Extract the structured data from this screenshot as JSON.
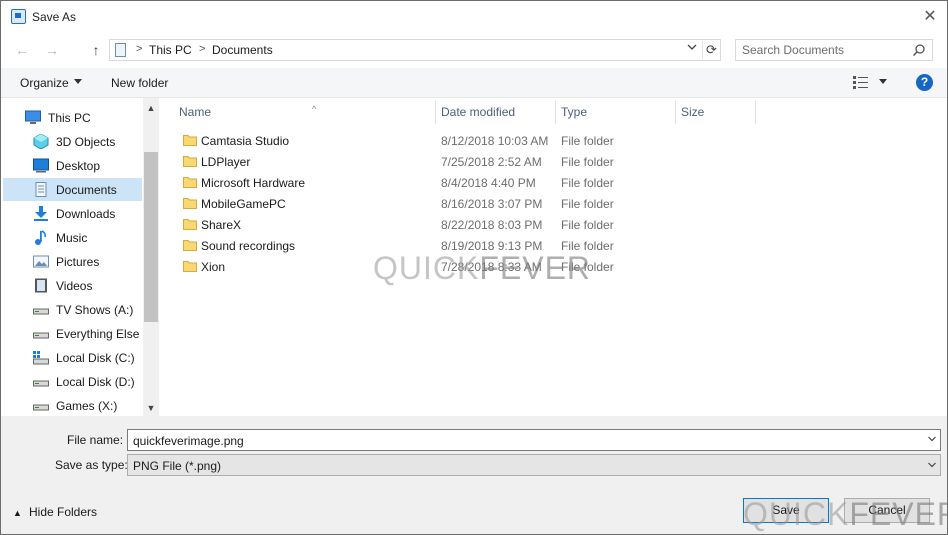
{
  "window": {
    "title": "Save As",
    "close_glyph": "✕"
  },
  "navigation": {
    "back_glyph": "←",
    "forward_glyph": "→",
    "up_glyph": "↑",
    "breadcrumb": [
      {
        "label": "This PC"
      },
      {
        "label": "Documents"
      }
    ],
    "separator_glyph": ">",
    "dropdown_glyph": "⌄",
    "refresh_glyph": "⟳"
  },
  "search": {
    "placeholder": "Search Documents",
    "icon": "search-icon"
  },
  "commandbar": {
    "organize_label": "Organize",
    "new_folder_label": "New folder",
    "help_label": "?",
    "view_icon": "view-options-icon"
  },
  "sidebar": {
    "items": [
      {
        "label": "This PC",
        "icon": "this-pc-icon",
        "root": true
      },
      {
        "label": "3D Objects",
        "icon": "3d-objects-icon"
      },
      {
        "label": "Desktop",
        "icon": "desktop-icon"
      },
      {
        "label": "Documents",
        "icon": "documents-icon",
        "selected": true
      },
      {
        "label": "Downloads",
        "icon": "downloads-icon"
      },
      {
        "label": "Music",
        "icon": "music-icon"
      },
      {
        "label": "Pictures",
        "icon": "pictures-icon"
      },
      {
        "label": "Videos",
        "icon": "videos-icon"
      },
      {
        "label": "TV Shows (A:)",
        "icon": "network-drive-icon"
      },
      {
        "label": "Everything Else (",
        "icon": "network-drive-icon"
      },
      {
        "label": "Local Disk (C:)",
        "icon": "local-disk-icon"
      },
      {
        "label": "Local Disk (D:)",
        "icon": "local-disk-icon"
      },
      {
        "label": "Games (X:)",
        "icon": "network-drive-icon"
      }
    ],
    "scroll_up_glyph": "▲",
    "scroll_down_glyph": "▼"
  },
  "filelist": {
    "columns": [
      {
        "label": "Name"
      },
      {
        "label": "Date modified"
      },
      {
        "label": "Type"
      },
      {
        "label": "Size"
      }
    ],
    "sort_glyph": "^",
    "rows": [
      {
        "name": "Camtasia Studio",
        "date": "8/12/2018 10:03 AM",
        "type": "File folder"
      },
      {
        "name": "LDPlayer",
        "date": "7/25/2018 2:52 AM",
        "type": "File folder"
      },
      {
        "name": "Microsoft Hardware",
        "date": "8/4/2018 4:40 PM",
        "type": "File folder"
      },
      {
        "name": "MobileGamePC",
        "date": "8/16/2018 3:07 PM",
        "type": "File folder"
      },
      {
        "name": "ShareX",
        "date": "8/22/2018 8:03 PM",
        "type": "File folder"
      },
      {
        "name": "Sound recordings",
        "date": "8/19/2018 9:13 PM",
        "type": "File folder"
      },
      {
        "name": "Xion",
        "date": "7/28/2018 8:33 AM",
        "type": "File folder"
      }
    ]
  },
  "watermark": {
    "part1": "QUICK",
    "part2": "FEVER"
  },
  "form": {
    "filename_label": "File name:",
    "filename_value": "quickfeverimage.png",
    "filetype_label": "Save as type:",
    "filetype_value": "PNG File (*.png)"
  },
  "footer": {
    "hide_folders_label": "Hide Folders",
    "hide_folders_glyph": "▲",
    "save_label": "Save",
    "cancel_label": "Cancel"
  },
  "colors": {
    "accent": "#0078d7",
    "selection": "#cce4f7",
    "folder": "#f8d775",
    "help": "#1666c5"
  }
}
